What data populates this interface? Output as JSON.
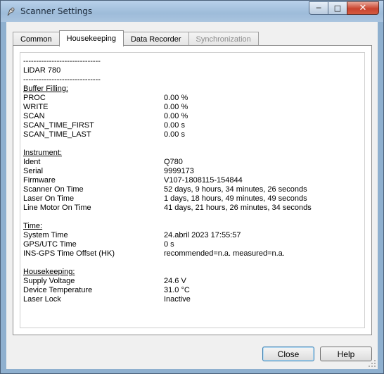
{
  "window": {
    "title": "Scanner Settings",
    "minimize_label": "─",
    "maximize_label": "□",
    "close_label": "✕"
  },
  "tabs": [
    {
      "label": "Common",
      "state": "normal"
    },
    {
      "label": "Housekeeping",
      "state": "active"
    },
    {
      "label": "Data Recorder",
      "state": "normal"
    },
    {
      "label": "Synchronization",
      "state": "disabled"
    }
  ],
  "housekeeping": {
    "separator_top": "------------------------------",
    "device_name": "LiDAR 780",
    "separator_bottom": "------------------------------",
    "buffer_filling": {
      "heading": "Buffer Filling:",
      "rows": [
        {
          "label": "PROC",
          "value": "0.00 %"
        },
        {
          "label": "WRITE",
          "value": "0.00 %"
        },
        {
          "label": "SCAN",
          "value": "0.00 %"
        },
        {
          "label": "SCAN_TIME_FIRST",
          "value": "0.00 s"
        },
        {
          "label": "SCAN_TIME_LAST",
          "value": "0.00 s"
        }
      ]
    },
    "instrument": {
      "heading": "Instrument:",
      "rows": [
        {
          "label": "Ident",
          "value": "Q780"
        },
        {
          "label": "Serial",
          "value": "9999173"
        },
        {
          "label": "Firmware",
          "value": "V107-1808115-154844"
        },
        {
          "label": "Scanner On Time",
          "value": "52 days, 9 hours, 34 minutes, 26 seconds"
        },
        {
          "label": "Laser On Time",
          "value": "1 days, 18 hours, 49 minutes, 49 seconds"
        },
        {
          "label": "Line Motor On Time",
          "value": "41 days, 21 hours, 26 minutes, 34 seconds"
        }
      ]
    },
    "time": {
      "heading": "Time:",
      "rows": [
        {
          "label": "System Time",
          "value": "24.abril 2023 17:55:57"
        },
        {
          "label": "GPS/UTC Time",
          "value": "0 s"
        },
        {
          "label": "INS-GPS Time Offset (HK)",
          "value": "recommended=n.a. measured=n.a."
        }
      ]
    },
    "housekeeping_section": {
      "heading": "Housekeeping:",
      "rows": [
        {
          "label": "Supply Voltage",
          "value": "24.6 V"
        },
        {
          "label": "Device Temperature",
          "value": "31.0 °C"
        },
        {
          "label": "Laser Lock",
          "value": "Inactive"
        }
      ]
    }
  },
  "buttons": {
    "close_label": "Close",
    "help_label": "Help"
  },
  "colors": {
    "title_bar": "#9dbbd9",
    "close_button": "#c9442f",
    "dialog_background": "#f0f0f0"
  }
}
